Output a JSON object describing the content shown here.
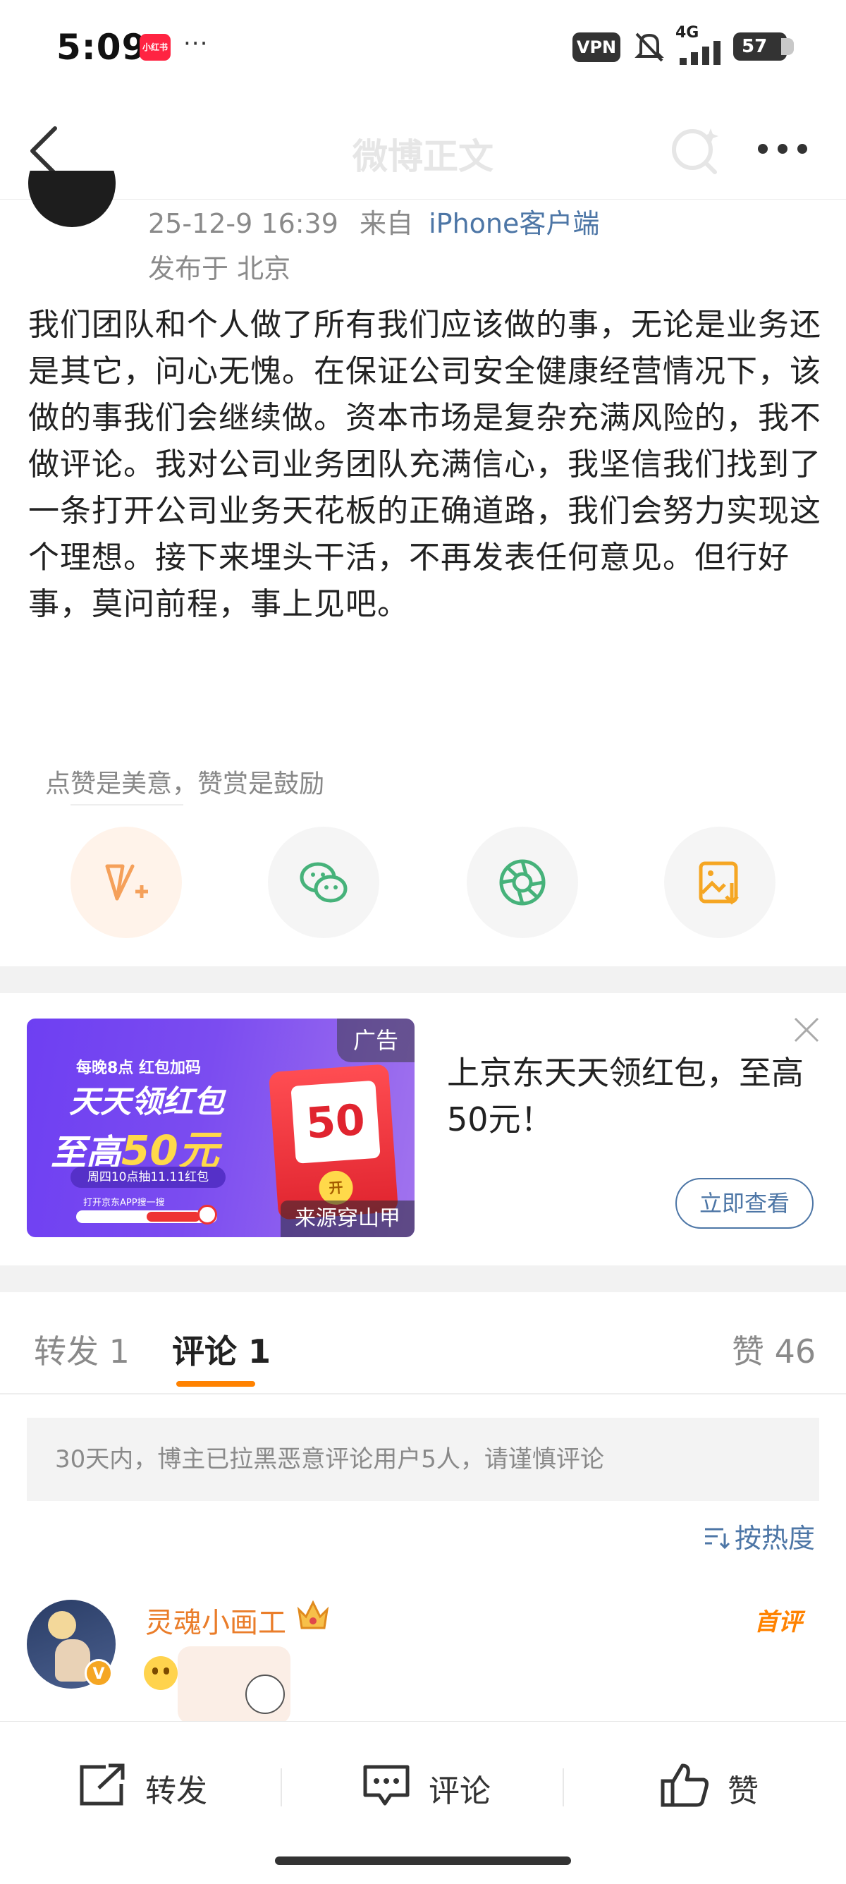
{
  "status_bar": {
    "time": "5:09",
    "app_badge": "小红书",
    "more_indicator": "···",
    "vpn": "VPN",
    "network": "4G",
    "battery": "57"
  },
  "nav": {
    "title": "微博正文",
    "back_icon": "chevron-left-icon",
    "search_icon": "search-icon",
    "more_icon": "more-dots-icon"
  },
  "post": {
    "timestamp": "25-12-9 16:39",
    "source_prefix": "来自",
    "source": "iPhone客户端",
    "location": "发布于 北京",
    "body": "我们团队和个人做了所有我们应该做的事，无论是业务还是其它，问心无愧。在保证公司安全健康经营情况下，该做的事我们会继续做。资本市场是复杂充满风险的，我不做评论。我对公司业务团队充满信心，我坚信我们找到了一条打开公司业务天花板的正确道路，我们会努力实现这个理想。接下来埋头干活，不再发表任何意见。但行好事，莫问前程，事上见吧。"
  },
  "reward": {
    "tip": "点赞是美意，赞赏是鼓励"
  },
  "share_buttons": [
    {
      "name": "reward-icon",
      "color": "#f5a05a"
    },
    {
      "name": "wechat-icon",
      "color": "#46b27a"
    },
    {
      "name": "moments-icon",
      "color": "#46b27a"
    },
    {
      "name": "save-image-icon",
      "color": "#f5a623"
    }
  ],
  "ad": {
    "banner_top": "每晚8点 红包加码",
    "banner_line1": "天天领红包",
    "banner_line2_prefix": "至高",
    "banner_line2_amount": "50元",
    "banner_chip": "周四10点抽11.11红包",
    "banner_tiny": "打开京东APP搜一搜",
    "redpack_amount": "50",
    "redpack_coin": "开",
    "tag": "广告",
    "source": "来源穿山甲",
    "title": "上京东天天领红包，至高50元！",
    "cta": "立即查看"
  },
  "tabs": {
    "forward": "转发 1",
    "comment": "评论 1",
    "like": "赞 46"
  },
  "notice": "30天内，博主已拉黑恶意评论用户5人，请谨慎评论",
  "sort": "按热度",
  "comment": {
    "username": "灵魂小画工",
    "verified": "V",
    "first_badge": "首评"
  },
  "bottom_bar": {
    "forward": "转发",
    "comment": "评论",
    "like": "赞"
  }
}
